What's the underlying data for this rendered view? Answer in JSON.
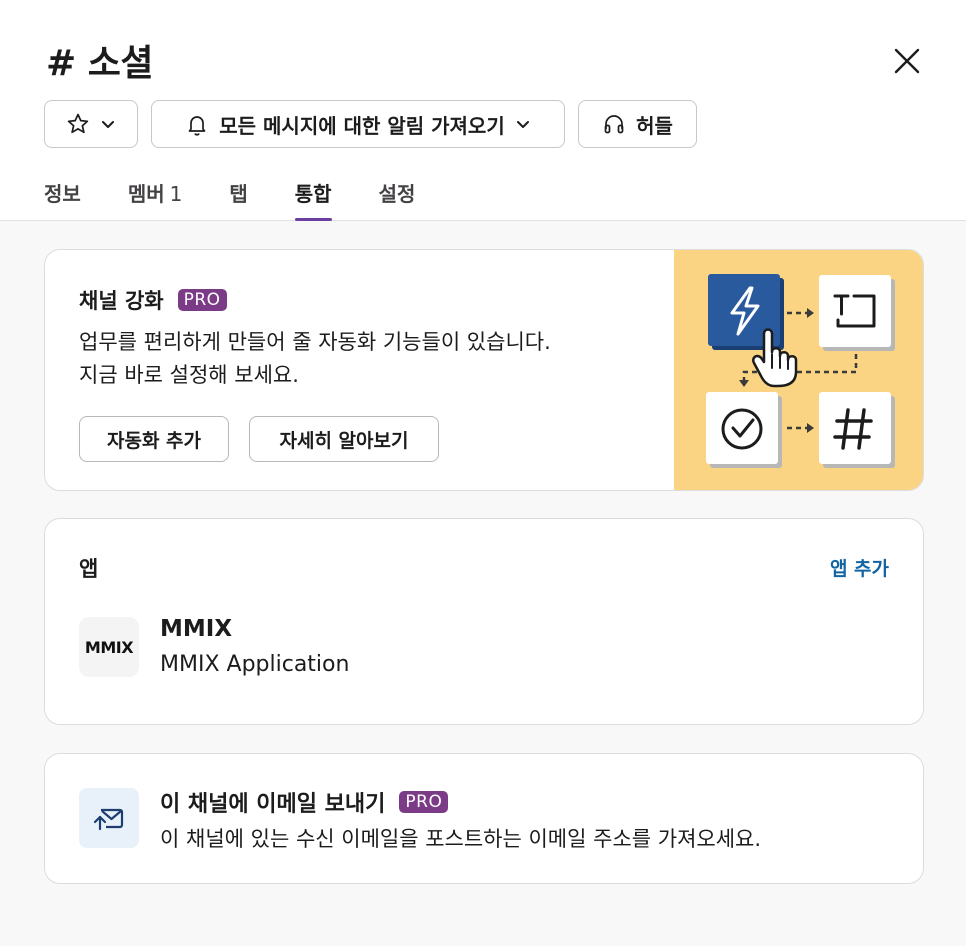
{
  "header": {
    "title": "# 소셜",
    "notify_label": "모든 메시지에 대한 알림 가져오기",
    "huddle_label": "허들"
  },
  "tabs": [
    {
      "label": "정보",
      "count": ""
    },
    {
      "label": "멤버",
      "count": "1"
    },
    {
      "label": "탭",
      "count": ""
    },
    {
      "label": "통합",
      "count": ""
    },
    {
      "label": "설정",
      "count": ""
    }
  ],
  "boost_card": {
    "title": "채널 강화",
    "badge": "PRO",
    "desc_line1": "업무를 편리하게 만들어 줄 자동화 기능들이 있습니다.",
    "desc_line2": "지금 바로 설정해 보세요.",
    "add_button": "자동화 추가",
    "learn_button": "자세히 알아보기"
  },
  "apps_card": {
    "title": "앱",
    "add_link": "앱 추가",
    "apps": [
      {
        "logo_text": "MMIX",
        "name": "MMIX",
        "description": "MMIX Application"
      }
    ]
  },
  "email_card": {
    "title": "이 채널에 이메일 보내기",
    "badge": "PRO",
    "desc": "이 채널에 있는 수신 이메일을 포스트하는 이메일 주소를 가져오세요."
  },
  "colors": {
    "accent": "#6b3fa0",
    "pro_badge": "#7b3b86",
    "link": "#1264a3",
    "illustration_bg": "#fbd483",
    "bolt_tile": "#2a5a9e"
  },
  "icons": [
    "star-icon",
    "chevron-down-icon",
    "bell-icon",
    "headphones-icon",
    "close-icon",
    "bolt-icon",
    "text-icon",
    "check-icon",
    "hash-icon",
    "pointer-hand-icon",
    "email-icon"
  ]
}
